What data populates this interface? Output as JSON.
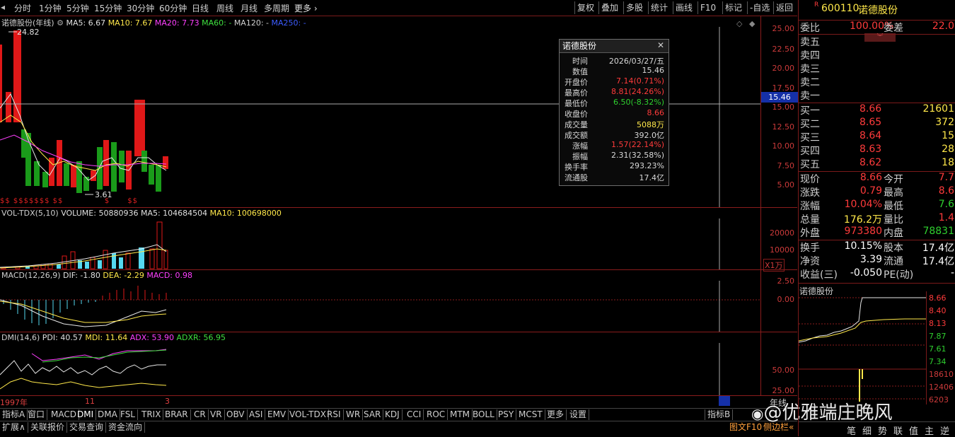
{
  "toolbar": {
    "periods": [
      "分时",
      "1分钟",
      "5分钟",
      "15分钟",
      "30分钟",
      "60分钟",
      "日线",
      "周线",
      "月线",
      "多周期",
      "更多"
    ],
    "actions": [
      "复权",
      "叠加",
      "多股",
      "统计",
      "画线",
      "F10",
      "标记",
      "-自选",
      "返回"
    ]
  },
  "main": {
    "title": "诺德股份(年线)",
    "ma5": "MA5: 6.67",
    "ma10": "MA10: 7.67",
    "ma20": "MA20: 7.73",
    "ma60": "MA60: -",
    "ma120": "MA120: -",
    "ma250": "MA250: -",
    "high_mark": "24.82",
    "low_mark": "3.61",
    "cursor_price": "15.46",
    "y_ticks": [
      "25.00",
      "22.50",
      "20.00",
      "17.50",
      "15.00",
      "12.50",
      "10.00",
      "7.50",
      "5.00"
    ]
  },
  "vol": {
    "title": "VOL-TDX(5,10)",
    "volume": "VOLUME: 50880936",
    "ma5": "MA5: 104684504",
    "ma10": "MA10: 100698000",
    "y_ticks": [
      "20000",
      "10000"
    ],
    "unit": "X1万"
  },
  "macd": {
    "title": "MACD(12,26,9)",
    "dif": "DIF: -1.80",
    "dea": "DEA: -2.29",
    "macd": "MACD: 0.98",
    "y_ticks": [
      "2.50",
      "0.00"
    ]
  },
  "dmi": {
    "title": "DMI(14,6)",
    "pdi": "PDI: 40.57",
    "mdi": "MDI: 11.64",
    "adx": "ADX: 53.90",
    "adxr": "ADXR: 56.95",
    "y_ticks": [
      "50.00",
      "25.00"
    ]
  },
  "timeline": {
    "labels": [
      "1997年",
      "11",
      "3"
    ],
    "axis_label": "年线"
  },
  "popup": {
    "title": "诺德股份",
    "rows": [
      {
        "label": "时间",
        "value": "2026/03/27/五",
        "color": "#d8d8d8"
      },
      {
        "label": "数值",
        "value": "15.46",
        "color": "#d8d8d8"
      },
      {
        "label": "开盘价",
        "value": "7.14(0.71%)",
        "color": "#ff3b3b"
      },
      {
        "label": "最高价",
        "value": "8.81(24.26%)",
        "color": "#ff3b3b"
      },
      {
        "label": "最低价",
        "value": "6.50(-8.32%)",
        "color": "#2fd02f"
      },
      {
        "label": "收盘价",
        "value": "8.66",
        "color": "#ff3b3b"
      },
      {
        "label": "成交量",
        "value": "5088万",
        "color": "#ffe84a"
      },
      {
        "label": "成交额",
        "value": "392.0亿",
        "color": "#d8d8d8"
      },
      {
        "label": "涨幅",
        "value": "1.57(22.14%)",
        "color": "#ff3b3b"
      },
      {
        "label": "振幅",
        "value": "2.31(32.58%)",
        "color": "#d8d8d8"
      },
      {
        "label": "换手率",
        "value": "293.23%",
        "color": "#d8d8d8"
      },
      {
        "label": "流通股",
        "value": "17.4亿",
        "color": "#d8d8d8"
      }
    ]
  },
  "indicator_tabs": [
    "指标A",
    "窗口",
    "MACD",
    "DMI",
    "DMA",
    "FSL",
    "TRIX",
    "BRAR",
    "CR",
    "VR",
    "OBV",
    "ASI",
    "EMV",
    "VOL-TDX",
    "RSI",
    "WR",
    "SAR",
    "KDJ",
    "CCI",
    "ROC",
    "MTM",
    "BOLL",
    "PSY",
    "MCST",
    "更多",
    "设置"
  ],
  "indicator_b": "指标B",
  "bottom_tabs": [
    "扩展",
    "关联报价",
    "交易查询",
    "资金流向"
  ],
  "bottom_right": [
    "图文F10",
    "侧边栏"
  ],
  "watermark": "@优雅端庄晚风",
  "quote": {
    "code": "600110",
    "name": "诺德股份",
    "weibi_label": "委比",
    "weibi": "100.00%",
    "weicha_label": "委差",
    "weicha": "22.0",
    "sells": [
      "卖五",
      "卖四",
      "卖三",
      "卖二",
      "卖一"
    ],
    "buys": [
      {
        "label": "买一",
        "price": "8.66",
        "vol": "21601"
      },
      {
        "label": "买二",
        "price": "8.65",
        "vol": "372"
      },
      {
        "label": "买三",
        "price": "8.64",
        "vol": "15"
      },
      {
        "label": "买四",
        "price": "8.63",
        "vol": "28"
      },
      {
        "label": "买五",
        "price": "8.62",
        "vol": "18"
      }
    ],
    "stats": [
      {
        "l1": "现价",
        "v1": "8.66",
        "c1": "red",
        "l2": "今开",
        "v2": "7.7",
        "c2": "red"
      },
      {
        "l1": "涨跌",
        "v1": "0.79",
        "c1": "red",
        "l2": "最高",
        "v2": "8.6",
        "c2": "red"
      },
      {
        "l1": "涨幅",
        "v1": "10.04%",
        "c1": "red",
        "l2": "最低",
        "v2": "7.6",
        "c2": "grn"
      },
      {
        "l1": "总量",
        "v1": "176.2万",
        "c1": "yel",
        "l2": "量比",
        "v2": "1.4",
        "c2": "red"
      },
      {
        "l1": "外盘",
        "v1": "973380",
        "c1": "red",
        "l2": "内盘",
        "v2": "78831",
        "c2": "grn"
      }
    ],
    "stats2": [
      {
        "l1": "换手",
        "v1": "10.15%",
        "l2": "股本",
        "v2": "17.4亿"
      },
      {
        "l1": "净资",
        "v1": "3.39",
        "l2": "流通",
        "v2": "17.4亿"
      },
      {
        "l1": "收益(三)",
        "v1": "-0.050",
        "l2": "PE(动)",
        "v2": "-"
      }
    ],
    "mini_title": "诺德股份",
    "mini_price_ticks": [
      "8.66",
      "8.40",
      "8.13",
      "7.87",
      "7.61",
      "7.34"
    ],
    "mini_vol_ticks": [
      "18610",
      "12406",
      "6203"
    ],
    "side_tabs": [
      "笔",
      "细",
      "势",
      "联",
      "值",
      "主",
      "逆"
    ]
  }
}
